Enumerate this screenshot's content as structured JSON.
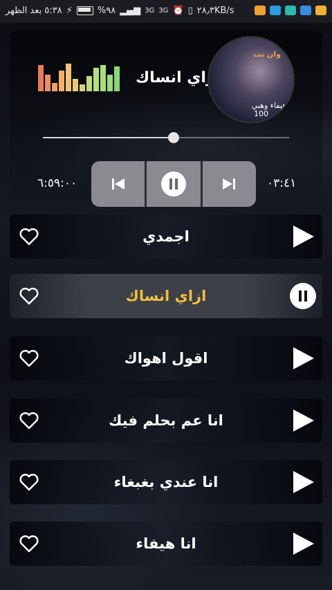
{
  "status_bar": {
    "speed": "٢٨٫٣KB/s",
    "time_label": "٥:٣٨ بعد الظهر",
    "battery": "%٩٨",
    "network_labels": [
      "3G",
      "3G"
    ]
  },
  "player": {
    "current_title": "ازاي انساك",
    "elapsed": "٠٣:٤١",
    "total": "٦:٥٩:٠٠",
    "progress_fraction": 0.53,
    "cover_lines": [
      "وان نت",
      "هيفاء وهبي",
      "100"
    ],
    "eq_colors": [
      "#e87d5a",
      "#f5c07a",
      "#a8e07a"
    ]
  },
  "songs": [
    {
      "title": "اجمدي",
      "state": "play"
    },
    {
      "title": "ازاي انساك",
      "state": "playing"
    },
    {
      "title": "اقول اهواك",
      "state": "play"
    },
    {
      "title": "انا عم بحلم فيك",
      "state": "play"
    },
    {
      "title": "انا عندي بغبغاء",
      "state": "play"
    },
    {
      "title": "انا هيفاء",
      "state": "play"
    }
  ],
  "colors": {
    "active_title": "#f0c040",
    "control_bg": "#8a8a90"
  }
}
